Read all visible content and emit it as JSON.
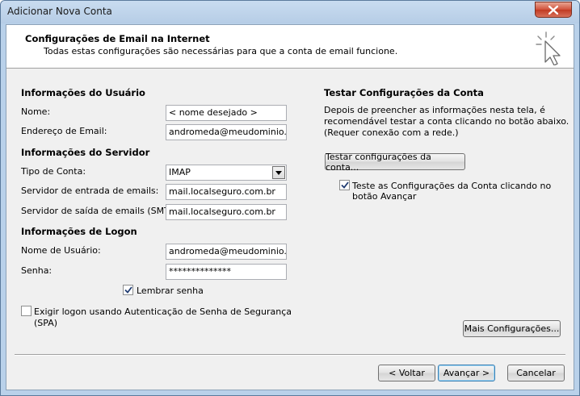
{
  "window": {
    "title": "Adicionar Nova Conta"
  },
  "header": {
    "title": "Configurações de Email na Internet",
    "subtitle": "Todas estas configurações são necessárias para que a conta de email funcione."
  },
  "user_info": {
    "section_title": "Informações do Usuário",
    "name_label": "Nome:",
    "name_value": "< nome desejado >",
    "email_label": "Endereço de Email:",
    "email_value": "andromeda@meudominio.com"
  },
  "server_info": {
    "section_title": "Informações do Servidor",
    "account_type_label": "Tipo de Conta:",
    "account_type_value": "IMAP",
    "incoming_label": "Servidor de entrada de emails:",
    "incoming_value": "mail.localseguro.com.br",
    "outgoing_label": "Servidor de saída de emails (SMTP):",
    "outgoing_value": "mail.localseguro.com.br"
  },
  "logon_info": {
    "section_title": "Informações de Logon",
    "username_label": "Nome de Usuário:",
    "username_value": "andromeda@meudominio.com",
    "password_label": "Senha:",
    "password_value": "**************",
    "remember_label": "Lembrar senha",
    "remember_checked": true,
    "spa_label_line1": "Exigir logon usando Autenticação de Senha de Segurança",
    "spa_label_line2": "(SPA)",
    "spa_checked": false
  },
  "test_settings": {
    "section_title": "Testar Configurações da Conta",
    "description_line1": "Depois de preencher as informações nesta tela, é",
    "description_line2": "recomendável testar a conta clicando no botão abaixo.",
    "description_line3": "(Requer conexão com a rede.)",
    "test_button": "Testar configurações da conta...",
    "auto_test_line1": "Teste as Configurações da Conta clicando no",
    "auto_test_line2": "botão Avançar",
    "auto_test_checked": true,
    "more_settings_button": "Mais Configurações..."
  },
  "footer": {
    "back_button": "< Voltar",
    "next_button": "Avançar >",
    "cancel_button": "Cancelar"
  },
  "colors": {
    "title_bar": "#c4d8ee",
    "dialog_bg": "#f0f0f0",
    "close_button": "#c8432c"
  },
  "icons": {
    "close": "close-icon",
    "header": "cursor-click-icon",
    "dropdown": "chevron-down-icon",
    "check": "check-icon"
  }
}
